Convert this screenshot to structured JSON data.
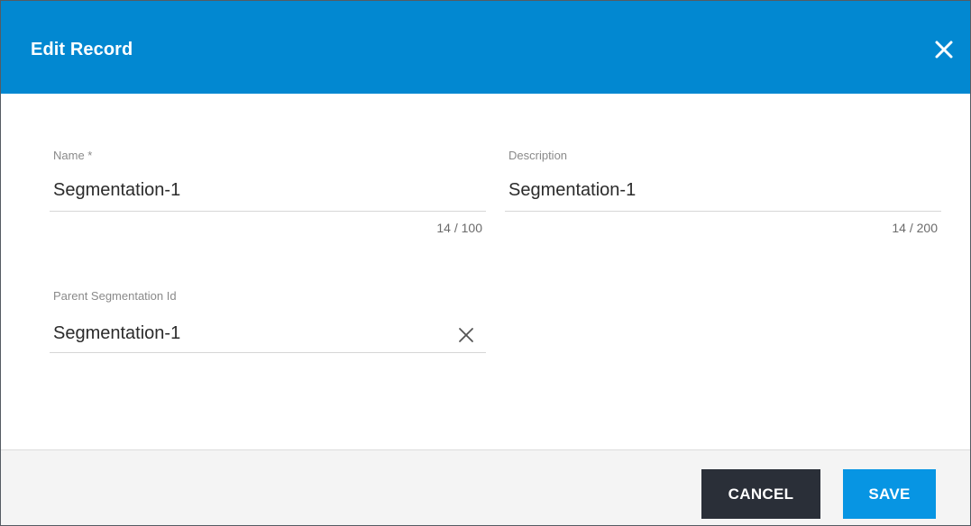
{
  "dialog": {
    "title": "Edit Record"
  },
  "fields": {
    "name": {
      "label": "Name *",
      "value": "Segmentation-1",
      "counter": "14 / 100"
    },
    "description": {
      "label": "Description",
      "value": "Segmentation-1",
      "counter": "14 / 200"
    },
    "parent": {
      "label": "Parent Segmentation Id",
      "value": "Segmentation-1"
    }
  },
  "footer": {
    "cancel_label": "CANCEL",
    "save_label": "SAVE"
  },
  "colors": {
    "header_bg": "#0288d1",
    "save_bg": "#0795e3",
    "cancel_bg": "#2a2f38"
  },
  "icons": {
    "close": "close-icon",
    "clear": "clear-icon"
  }
}
